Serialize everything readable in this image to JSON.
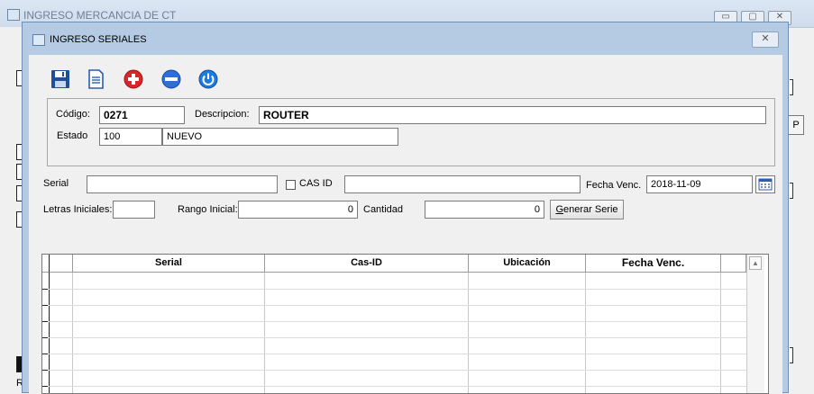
{
  "background_window": {
    "title": "INGRESO MERCANCIA DE CT",
    "p_button_label": "P",
    "r_label": "R",
    "controls": [
      "▭",
      "▢",
      "✕"
    ]
  },
  "dialog": {
    "title": "INGRESO SERIALES",
    "close_label": "✕"
  },
  "toolbar": {
    "items": [
      {
        "name": "save-icon",
        "color": "#1f4f9a"
      },
      {
        "name": "document-icon",
        "color": "#2a5db0"
      },
      {
        "name": "add-icon",
        "color": "#d9262b"
      },
      {
        "name": "remove-icon",
        "color": "#2d6fd6"
      },
      {
        "name": "power-icon",
        "color": "#1c7be0"
      }
    ]
  },
  "product": {
    "codigo_label": "Código:",
    "codigo_value": "0271",
    "descripcion_label": "Descripcion:",
    "descripcion_value": "ROUTER",
    "estado_label": "Estado",
    "estado_code": "100",
    "estado_desc": "NUEVO"
  },
  "entry": {
    "serial_label": "Serial",
    "serial_value": "",
    "cas_id_label": "CAS ID",
    "cas_id_checked": false,
    "cas_id_value": "",
    "fecha_venc_label": "Fecha Venc.",
    "fecha_venc_value": "2018-11-09",
    "letras_iniciales_label": "Letras Iniciales:",
    "letras_iniciales_value": "",
    "rango_inicial_label": "Rango Inicial:",
    "rango_inicial_value": "0",
    "cantidad_label": "Cantidad",
    "cantidad_value": "0",
    "generar_accel": "G",
    "generar_rest": "enerar Serie"
  },
  "grid": {
    "columns": [
      "Serial",
      "Cas-ID",
      "Ubicación",
      "Fecha Venc."
    ],
    "rows": [],
    "scroll_up": "▲"
  }
}
